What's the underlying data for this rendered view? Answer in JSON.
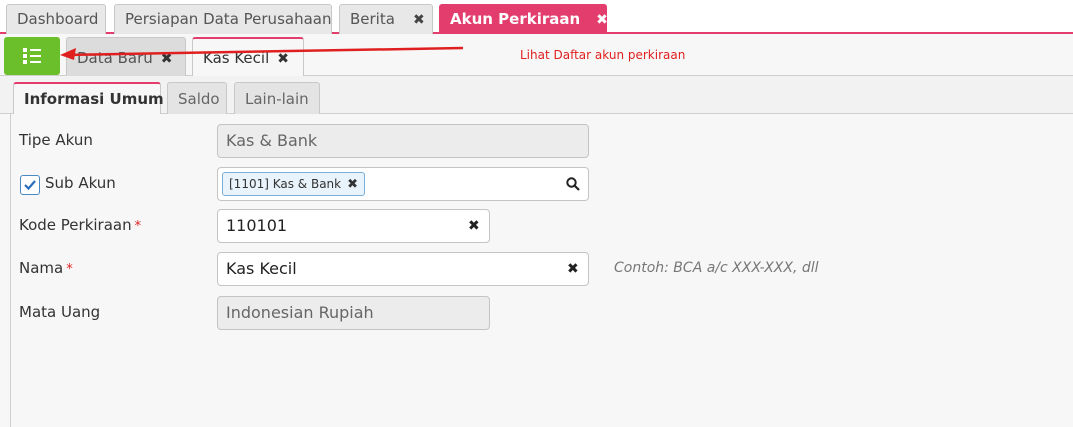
{
  "top_tabs": [
    {
      "label": "Dashboard"
    },
    {
      "label": "Persiapan Data Perusahaan"
    },
    {
      "label": "Berita",
      "close": "✖"
    },
    {
      "label": "Akun Perkiraan",
      "close": "✖"
    }
  ],
  "sub_tabs": [
    {
      "label": "Data Baru",
      "close": "✖"
    },
    {
      "label": "Kas Kecil",
      "close": "✖"
    }
  ],
  "annotation": "Lihat Daftar akun perkiraan",
  "form_tabs": [
    "Informasi Umum",
    "Saldo",
    "Lain-lain"
  ],
  "form": {
    "tipe_akun": {
      "label": "Tipe Akun",
      "value": "Kas & Bank"
    },
    "sub_akun": {
      "label": "Sub Akun",
      "checked": true,
      "chip": "[1101] Kas & Bank",
      "chip_close": "✖"
    },
    "kode_perkiraan": {
      "label": "Kode Perkiraan",
      "required": "*",
      "value": "110101",
      "clear": "✖"
    },
    "nama": {
      "label": "Nama",
      "required": "*",
      "value": "Kas Kecil",
      "clear": "✖",
      "hint": "Contoh: BCA a/c XXX-XXX, dll"
    },
    "mata_uang": {
      "label": "Mata Uang",
      "value": "Indonesian Rupiah"
    }
  },
  "colors": {
    "accent": "#e23d6d",
    "list_button": "#6bbf2a",
    "annotation": "#e02020"
  },
  "icons": [
    "list-icon",
    "search-icon",
    "check-icon",
    "close-icon",
    "arrow-left-icon"
  ]
}
